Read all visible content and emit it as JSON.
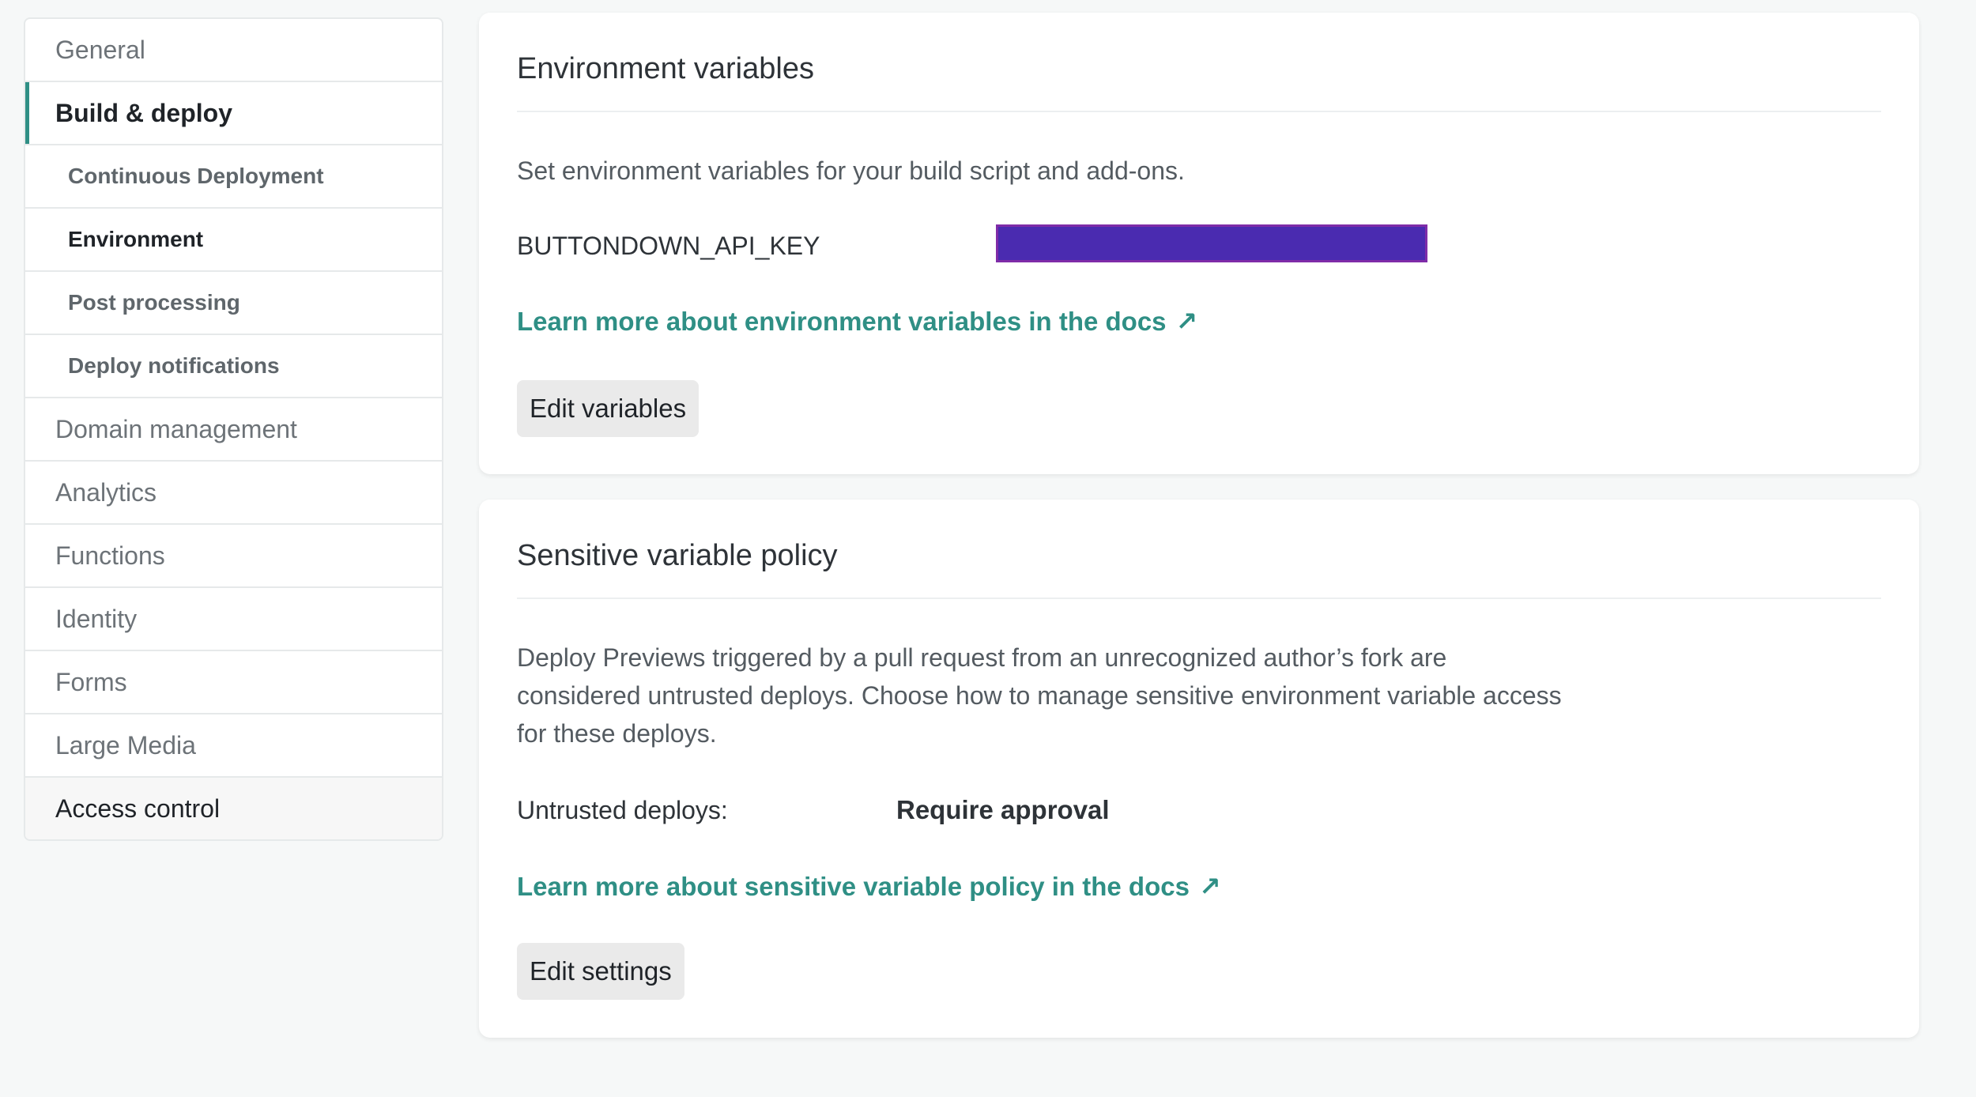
{
  "sidebar": {
    "items": [
      {
        "label": "General"
      },
      {
        "label": "Build & deploy"
      },
      {
        "label": "Continuous Deployment"
      },
      {
        "label": "Environment"
      },
      {
        "label": "Post processing"
      },
      {
        "label": "Deploy notifications"
      },
      {
        "label": "Domain management"
      },
      {
        "label": "Analytics"
      },
      {
        "label": "Functions"
      },
      {
        "label": "Identity"
      },
      {
        "label": "Forms"
      },
      {
        "label": "Large Media"
      },
      {
        "label": "Access control"
      }
    ]
  },
  "env_card": {
    "title": "Environment variables",
    "description": "Set environment variables for your build script and add-ons.",
    "variable_key": "BUTTONDOWN_API_KEY",
    "learn_more": "Learn more about environment variables in the docs",
    "arrow": "↗",
    "button": "Edit variables"
  },
  "policy_card": {
    "title": "Sensitive variable policy",
    "description_lines": [
      "Deploy Previews triggered by a pull request from an unrecognized author’s fork are",
      "considered untrusted deploys. Choose how to manage sensitive environment variable access",
      "for these deploys."
    ],
    "untrusted_label": "Untrusted deploys:",
    "untrusted_value": "Require approval",
    "learn_more": "Learn more about sensitive variable policy in the docs",
    "arrow": "↗",
    "button": "Edit settings"
  },
  "colors": {
    "accent": "#2f8f85",
    "redaction": "#4a2bb0"
  }
}
